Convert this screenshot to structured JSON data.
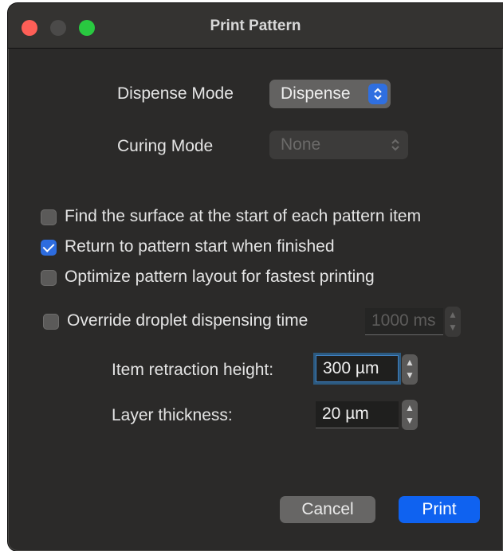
{
  "window": {
    "title": "Print Pattern"
  },
  "dispense": {
    "label": "Dispense Mode",
    "value": "Dispense"
  },
  "curing": {
    "label": "Curing Mode",
    "value": "None"
  },
  "options": [
    {
      "label": "Find the surface at the start of each pattern item",
      "checked": false
    },
    {
      "label": "Return to pattern start when finished",
      "checked": true
    },
    {
      "label": "Optimize pattern layout for fastest printing",
      "checked": false
    }
  ],
  "override": {
    "label": "Override droplet dispensing time",
    "checked": false,
    "value": "1000 ms"
  },
  "retraction": {
    "label": "Item retraction height:",
    "value": "300 µm"
  },
  "layer": {
    "label": "Layer thickness:",
    "value": "20 µm"
  },
  "buttons": {
    "cancel": "Cancel",
    "print": "Print"
  },
  "icons": {
    "popup_stepper": "⌃⌄",
    "spin_up": "▲",
    "spin_down": "▼"
  },
  "colors": {
    "accent": "#0f62f0",
    "close": "#fe5f57",
    "zoom": "#29c940"
  }
}
